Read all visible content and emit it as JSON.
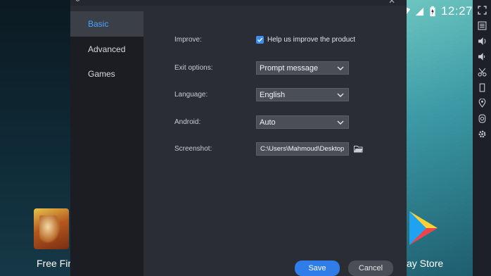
{
  "status_bar": {
    "time": "12:27",
    "wifi_icon": "wifi-icon",
    "signal_icon": "signal-icon",
    "battery_icon": "battery-icon"
  },
  "toolbar": {
    "icons": [
      "fullscreen-icon",
      "menu-icon",
      "volume-up-icon",
      "volume-down-icon",
      "scissors-icon",
      "shake-icon",
      "location-icon",
      "camera-icon",
      "settings-icon"
    ]
  },
  "apps": [
    {
      "label": "Free Fir",
      "icon": "free-fire-icon"
    },
    {
      "label": "ay Store",
      "icon": "play-store-icon"
    }
  ],
  "settings": {
    "sidebar": [
      {
        "label": "Basic",
        "active": true
      },
      {
        "label": "Advanced",
        "active": false
      },
      {
        "label": "Games",
        "active": false
      }
    ],
    "improve": {
      "label": "Improve:",
      "checkbox_label": "Help us improve the product",
      "checked": true
    },
    "exit_options": {
      "label": "Exit options:",
      "value": "Prompt message"
    },
    "language": {
      "label": "Language:",
      "value": "English"
    },
    "android": {
      "label": "Android:",
      "value": "Auto"
    },
    "screenshot": {
      "label": "Screenshot:",
      "path": "C:\\Users\\Mahmoud\\Desktop"
    },
    "save_label": "Save",
    "cancel_label": "Cancel"
  },
  "colors": {
    "accent": "#2f7de8",
    "active_text": "#4aa3ff",
    "panel": "#2a2d34",
    "sidebar": "#1b1d22"
  }
}
